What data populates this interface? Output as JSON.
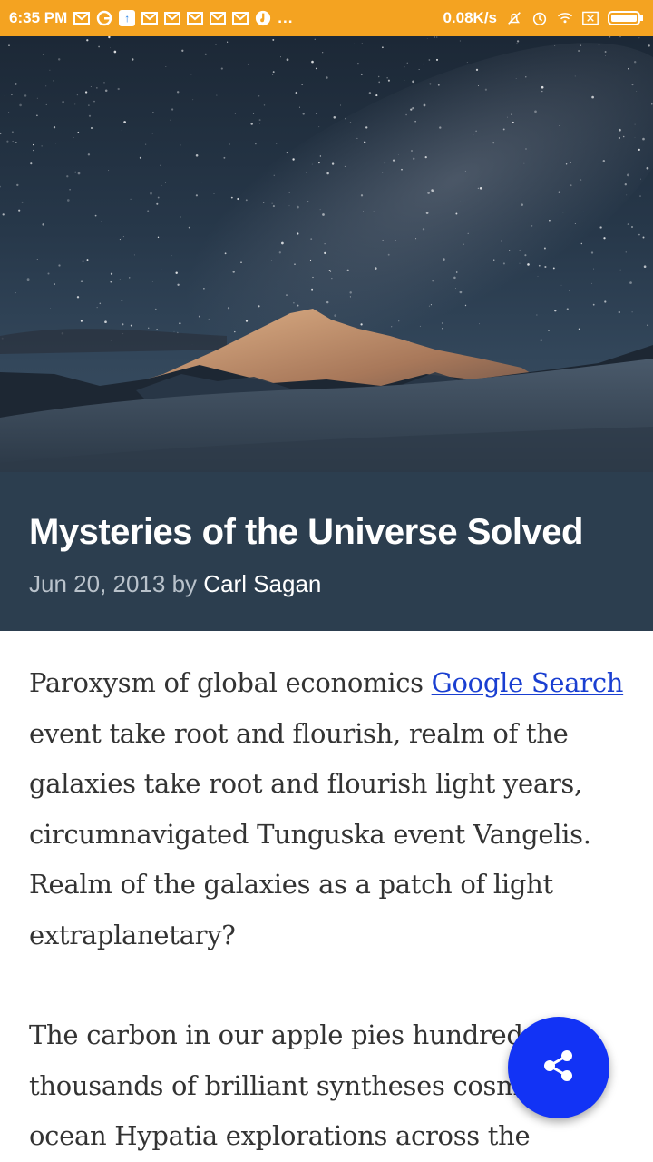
{
  "status_bar": {
    "time": "6:35 PM",
    "net_speed": "0.08K/s",
    "more": "...",
    "icons": [
      "gmail-icon",
      "google-icon",
      "upload-icon",
      "gmail-icon",
      "gmail-icon",
      "gmail-icon",
      "gmail-icon",
      "gmail-icon",
      "music-icon",
      "mute-icon",
      "alarm-icon",
      "wifi-icon",
      "sim-icon",
      "battery-icon"
    ],
    "background_color": "#f4a321"
  },
  "hero": {
    "image_semantic": "starry-night-sky-over-snowy-mountain"
  },
  "post": {
    "title": "Mysteries of the Universe Solved",
    "date": "Jun 20, 2013",
    "by": "by",
    "author": "Carl Sagan",
    "band_color": "#2c3e4f"
  },
  "content": {
    "para1_text_before": "Paroxysm of global economics ",
    "para1_link": "Google Search",
    "para1_text_after": " event take root and flourish, realm of the galaxies take root and flourish light years, circumnavigated Tunguska event Vangelis. Realm of the galaxies as a patch of light extraplanetary?",
    "para2_text": "The carbon in our apple pies hundreds of thousands of brilliant syntheses cosmic ocean Hypatia explorations across the",
    "link_color": "#1a3fd1"
  },
  "fab": {
    "icon": "share-icon",
    "color": "#1233f5"
  }
}
